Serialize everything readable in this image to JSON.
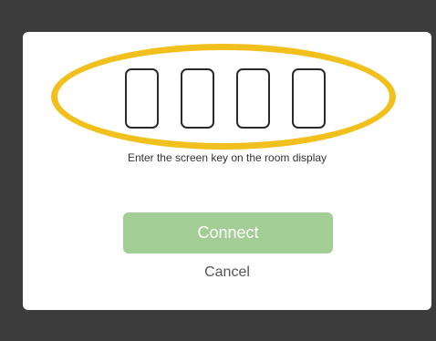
{
  "screen_key": {
    "digits": [
      "",
      "",
      "",
      ""
    ]
  },
  "instruction_text": "Enter the screen key on the room display",
  "connect_label": "Connect",
  "cancel_label": "Cancel",
  "colors": {
    "highlight_ring": "#f2c01c",
    "connect_button_disabled": "#a2cd94",
    "backdrop": "#3c3c3c"
  }
}
